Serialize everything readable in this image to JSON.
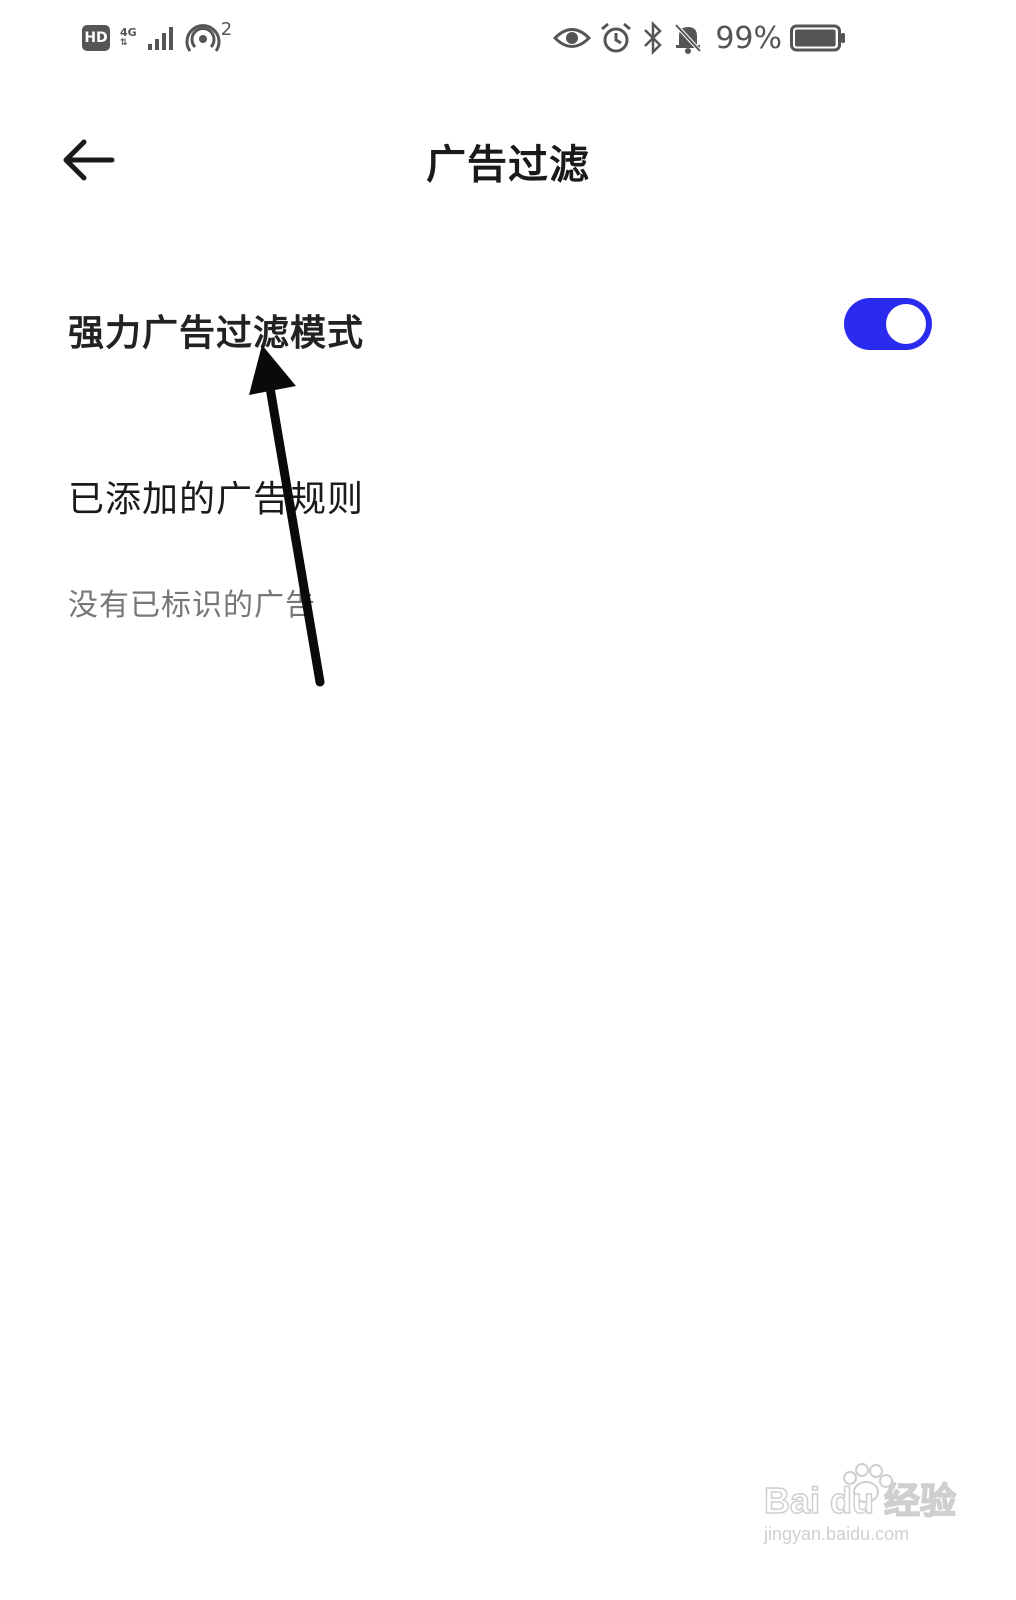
{
  "status_bar": {
    "hd_badge": "HD",
    "network_type": "4G",
    "hotspot_count": "2",
    "battery_percent": "99%",
    "icons": [
      "hd-icon",
      "signal-icon",
      "hotspot-icon",
      "eye-icon",
      "alarm-icon",
      "bluetooth-icon",
      "mute-bell-icon",
      "battery-icon"
    ],
    "battery_level": 0.99
  },
  "header": {
    "title": "广告过滤",
    "back_icon": "arrow-left-icon"
  },
  "settings": {
    "strong_filter_label": "强力广告过滤模式",
    "strong_filter_enabled": true
  },
  "rules": {
    "section_title": "已添加的广告规则",
    "empty_text": "没有已标识的广告"
  },
  "watermark": {
    "logo": "Bai du 经验",
    "url": "jingyan.baidu.com"
  },
  "colors": {
    "accent": "#2b2bf0",
    "text_primary": "#1a1a1a",
    "text_secondary": "#777777",
    "background": "#ffffff"
  }
}
